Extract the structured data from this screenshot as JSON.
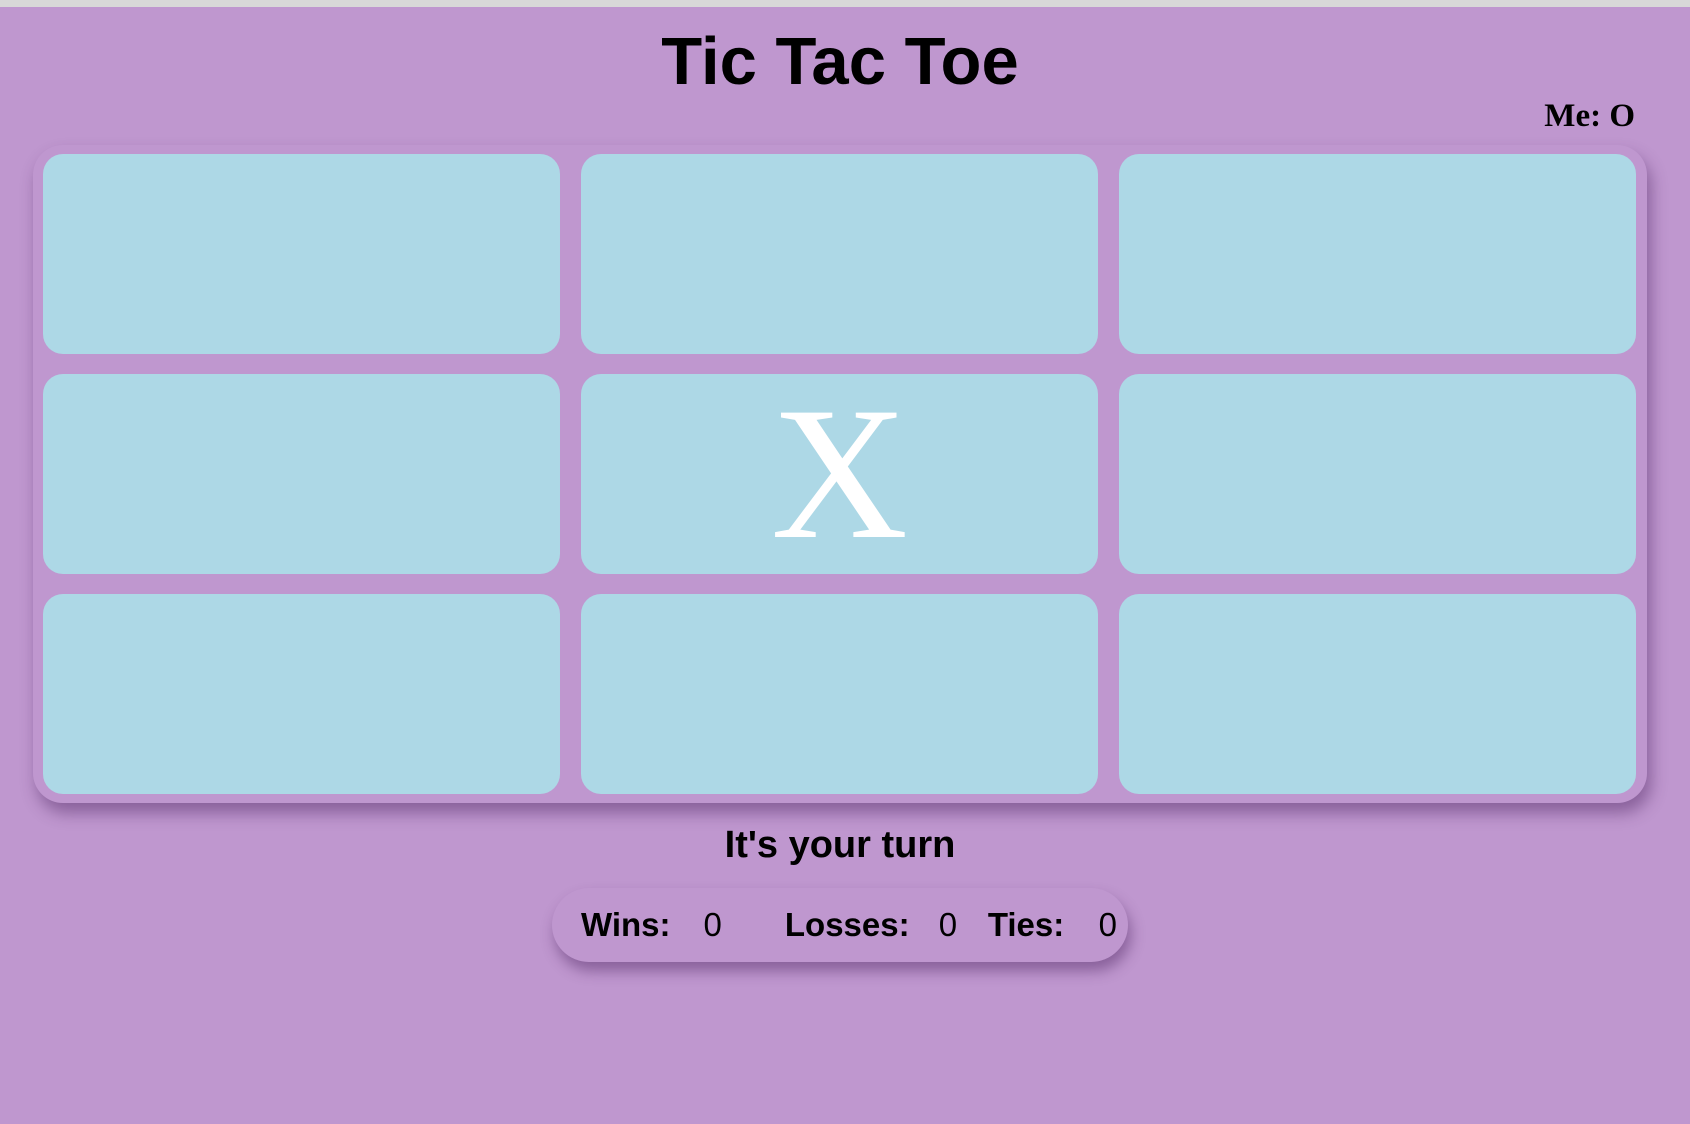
{
  "title": "Tic Tac Toe",
  "player": {
    "me_label": "Me: O"
  },
  "board": {
    "cells": [
      "",
      "",
      "",
      "",
      "X",
      "",
      "",
      "",
      ""
    ]
  },
  "status": "It's your turn",
  "score": {
    "wins_label": "Wins:",
    "wins": "0",
    "losses_label": "Losses:",
    "losses": "0",
    "ties_label": "Ties:",
    "ties": "0"
  },
  "colors": {
    "background": "#bf97cf",
    "cell": "#add8e6",
    "mark": "#ffffff"
  }
}
